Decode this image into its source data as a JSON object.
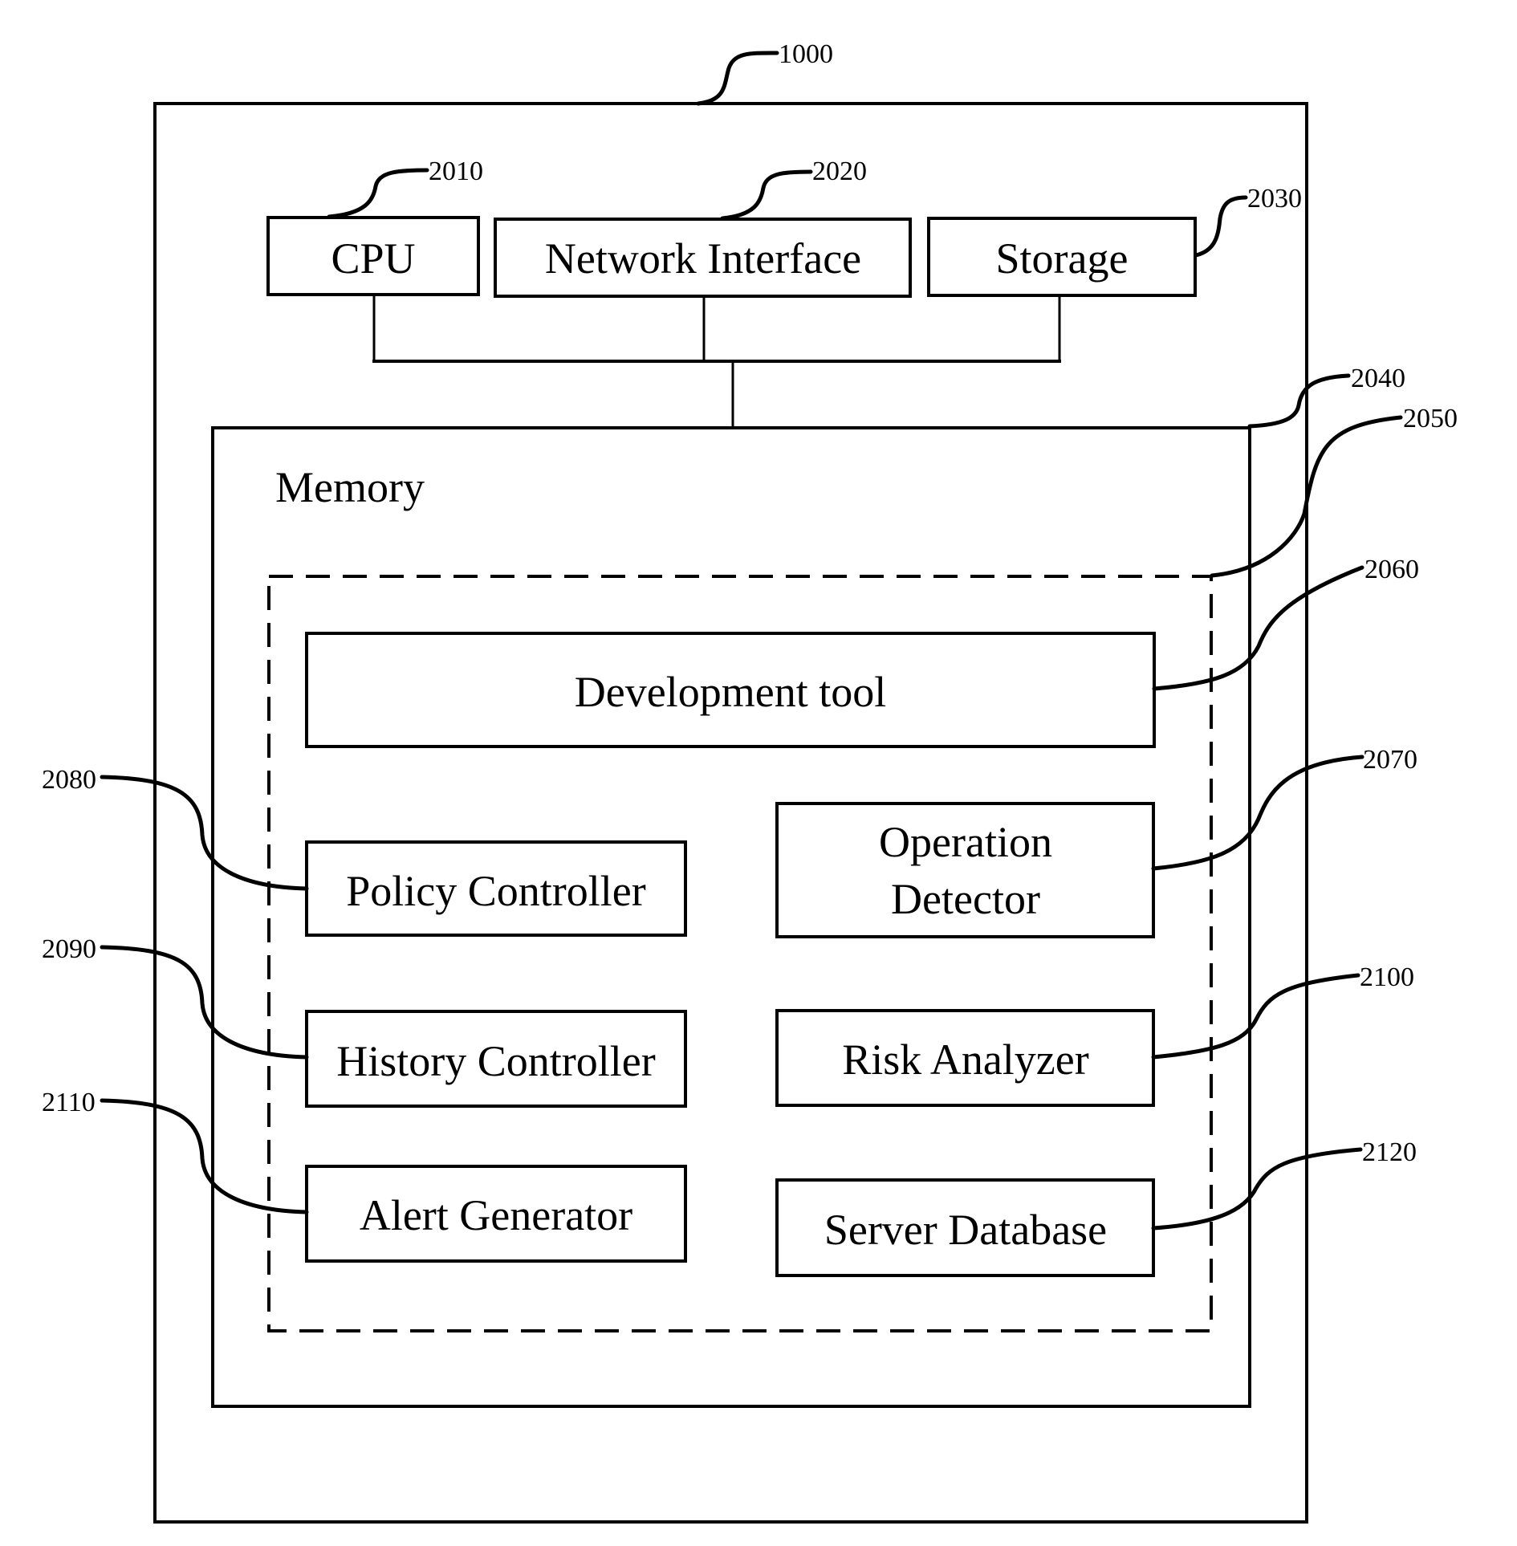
{
  "figure": {
    "system": {
      "ref": "1000"
    },
    "cpu": {
      "label": "CPU",
      "ref": "2010"
    },
    "network_interface": {
      "label": "Network Interface",
      "ref": "2020"
    },
    "storage": {
      "label": "Storage",
      "ref": "2030"
    },
    "memory": {
      "label": "Memory",
      "ref": "2040"
    },
    "program_group": {
      "ref": "2050"
    },
    "development_tool": {
      "label": "Development tool",
      "ref": "2060"
    },
    "operation_detector": {
      "label_line1": "Operation",
      "label_line2": "Detector",
      "ref": "2070"
    },
    "policy_controller": {
      "label": "Policy Controller",
      "ref": "2080"
    },
    "history_controller": {
      "label": "History Controller",
      "ref": "2090"
    },
    "risk_analyzer": {
      "label": "Risk Analyzer",
      "ref": "2100"
    },
    "alert_generator": {
      "label": "Alert Generator",
      "ref": "2110"
    },
    "server_database": {
      "label": "Server Database",
      "ref": "2120"
    }
  }
}
